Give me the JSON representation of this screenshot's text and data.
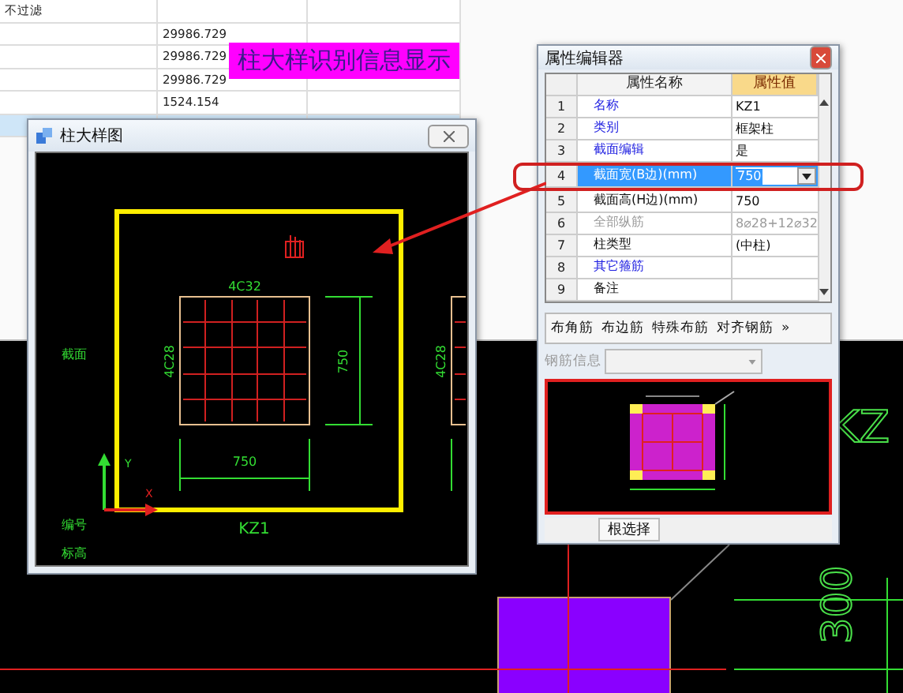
{
  "table": {
    "rows": [
      {
        "column_1": "不过滤",
        "selected": false
      },
      {
        "column_2": "29986.729",
        "selected": false
      },
      {
        "column_2": "29986.729",
        "selected": false
      },
      {
        "column_2": "29986.729",
        "selected": false
      },
      {
        "column_2": "1524.154",
        "selected": false
      },
      {
        "selected": true
      }
    ]
  },
  "banner": "柱大样识别信息显示",
  "detail_window": {
    "title": "柱大样图",
    "drawing": {
      "top_rebar": "4C32",
      "side_rebar": "4C28",
      "side_rebar_next": "4C28",
      "width_dim": "750",
      "height_dim": "750",
      "column_name": "KZ1",
      "axis_y": "Y",
      "axis_x": "X",
      "labels": [
        "截面",
        "编号",
        "标高"
      ]
    }
  },
  "property_editor": {
    "title": "属性编辑器",
    "columns": [
      "属性名称",
      "属性值"
    ],
    "rows": [
      {
        "index": "1",
        "name": "名称",
        "value": "KZ1",
        "kind": "link",
        "selected": false
      },
      {
        "index": "2",
        "name": "类别",
        "value": "框架柱",
        "kind": "link",
        "selected": false
      },
      {
        "index": "3",
        "name": "截面编辑",
        "value": "是",
        "kind": "link",
        "selected": false
      },
      {
        "index": "4",
        "name": "截面宽(B边)(mm)",
        "value": "750",
        "kind": "link",
        "selected": true
      },
      {
        "index": "5",
        "name": "截面高(H边)(mm)",
        "value": "750",
        "kind": "normal",
        "selected": false
      },
      {
        "index": "6",
        "name": "全部纵筋",
        "value": "8⌀28+12⌀32",
        "kind": "disabled",
        "selected": false
      },
      {
        "index": "7",
        "name": "柱类型",
        "value": "(中柱)",
        "kind": "normal",
        "selected": false
      },
      {
        "index": "8",
        "name": "其它箍筋",
        "kind": "link",
        "selected": false
      },
      {
        "index": "9",
        "name": "备注",
        "kind": "normal",
        "selected": false
      }
    ],
    "tools": [
      "布角筋",
      "布边筋",
      "特殊布筋",
      "对齐钢筋"
    ],
    "more": "»",
    "rebar_info": {
      "label": "钢筋信息",
      "disabled": true
    },
    "footer_button": "根选择"
  },
  "canvas": {
    "column_label": "KZ",
    "dimension": "300"
  }
}
